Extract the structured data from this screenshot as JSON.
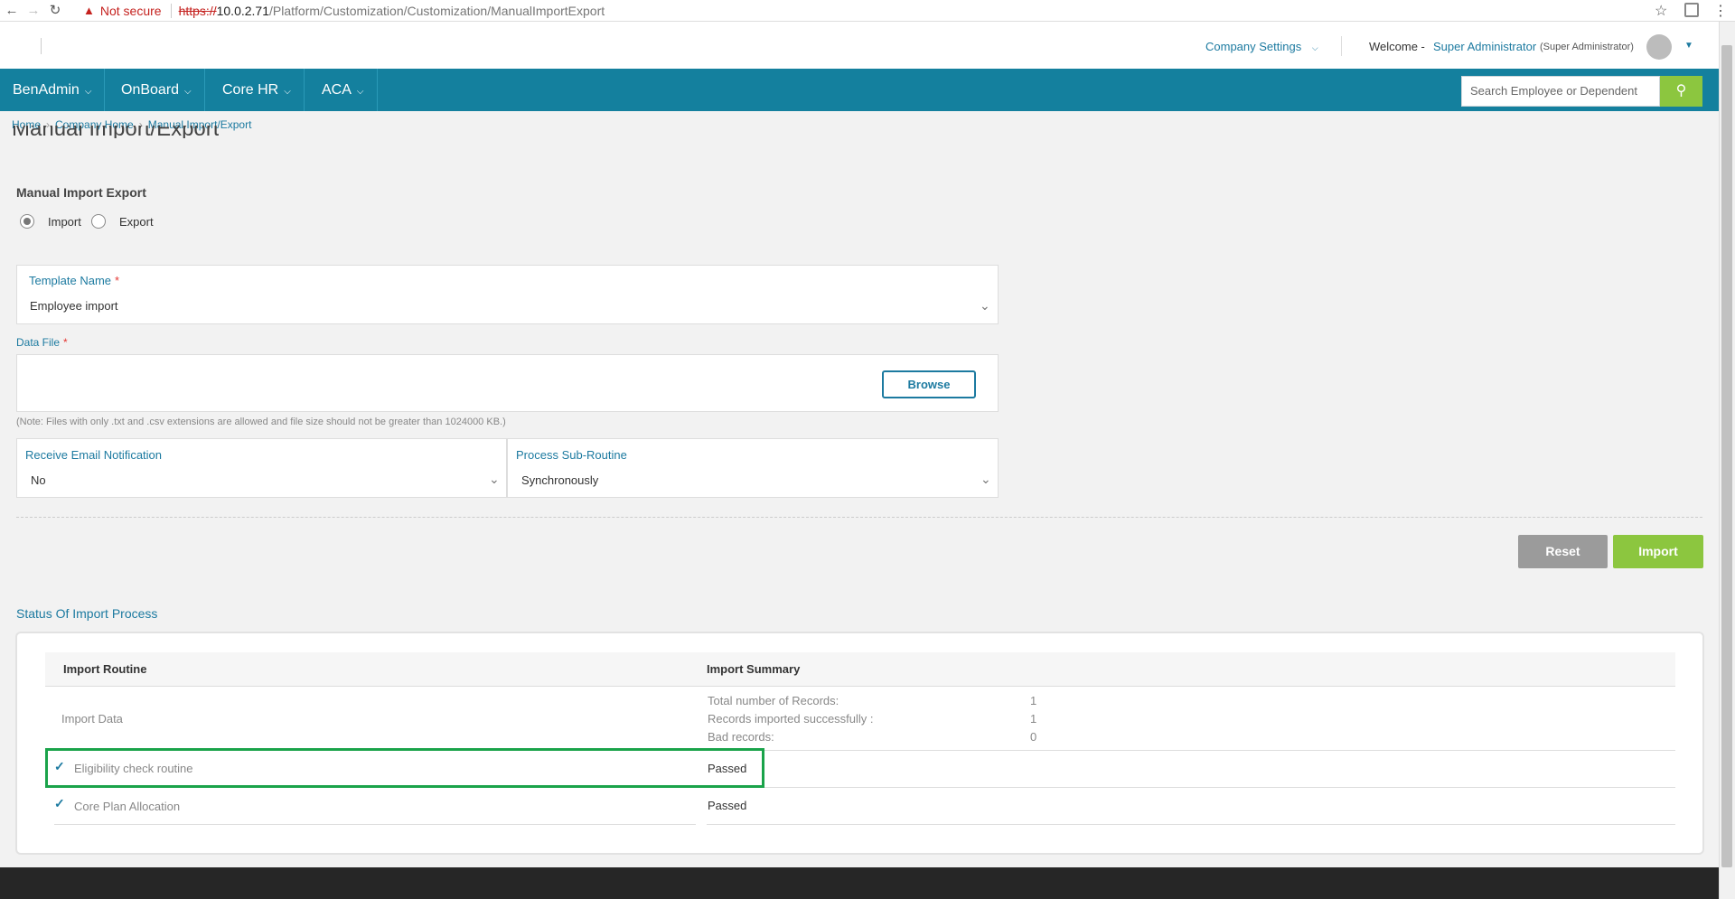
{
  "browser": {
    "not_secure": "Not secure",
    "url_scheme": "https://",
    "url_host": "10.0.2.71",
    "url_path": "/Platform/Customization/Customization/ManualImportExport"
  },
  "header": {
    "company_settings": "Company Settings",
    "welcome": "Welcome -",
    "user_name": "Super Administrator",
    "user_role": "(Super Administrator)"
  },
  "nav": {
    "items": [
      "BenAdmin",
      "OnBoard",
      "Core HR",
      "ACA"
    ],
    "search_placeholder": "Search Employee or Dependent"
  },
  "breadcrumb": [
    "Home",
    "Company Home",
    "Manual Import/Export"
  ],
  "page_title": "Manual Import/Export",
  "form": {
    "section_title": "Manual Import Export",
    "radio_import": "Import",
    "radio_export": "Export",
    "selected_mode": "Import",
    "template_label": "Template Name",
    "template_value": "Employee import",
    "data_file_label": "Data File",
    "browse": "Browse",
    "note": "(Note: Files with only .txt and .csv extensions are allowed and file size should not be greater than 1024000 KB.)",
    "email_label": "Receive Email Notification",
    "email_value": "No",
    "subroutine_label": "Process Sub-Routine",
    "subroutine_value": "Synchronously",
    "reset": "Reset",
    "import": "Import"
  },
  "status": {
    "title": "Status Of Import Process",
    "col_routine": "Import Routine",
    "col_summary": "Import Summary",
    "rows": [
      {
        "routine": "Import Data",
        "summary": [
          {
            "label": "Total number of Records:",
            "value": "1"
          },
          {
            "label": "Records imported successfully :",
            "value": "1"
          },
          {
            "label": "Bad records:",
            "value": "0"
          }
        ]
      },
      {
        "routine": "Eligibility check routine",
        "result": "Passed",
        "checked": true,
        "highlighted": true
      },
      {
        "routine": "Core Plan Allocation",
        "result": "Passed",
        "checked": true
      }
    ]
  },
  "colors": {
    "nav_bg": "#14809e",
    "accent": "#1c7aa0",
    "green": "#8cc63f",
    "highlight": "#1aa34a"
  }
}
